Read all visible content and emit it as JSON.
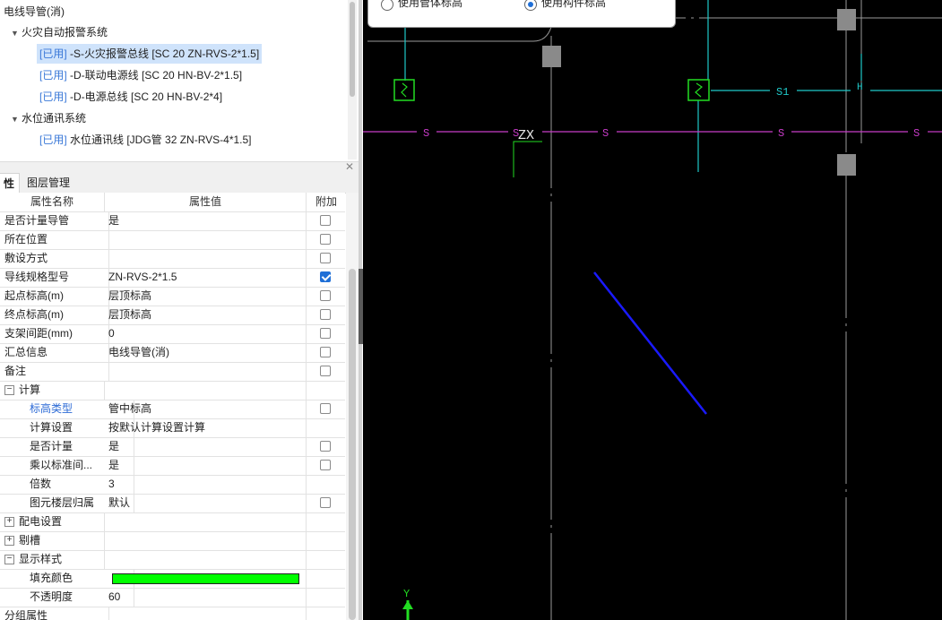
{
  "tree": {
    "root_label": "电线导管(消)",
    "groups": [
      {
        "label": "火灾自动报警系统",
        "items": [
          {
            "tag": "[已用]",
            "text": "-S-火灾报警总线 [SC 20 ZN-RVS-2*1.5]",
            "selected": true
          },
          {
            "tag": "[已用]",
            "text": "-D-联动电源线 [SC 20 HN-BV-2*1.5]"
          },
          {
            "tag": "[已用]",
            "text": "-D-电源总线 [SC 20 HN-BV-2*4]"
          }
        ]
      },
      {
        "label": "水位通讯系统",
        "items": [
          {
            "tag": "[已用]",
            "text": "水位通讯线 [JDG管 32 ZN-RVS-4*1.5]"
          }
        ]
      }
    ]
  },
  "tabs": {
    "properties": "性",
    "layers": "图层管理"
  },
  "grid": {
    "headers": {
      "name": "属性名称",
      "value": "属性值",
      "extra": "附加"
    },
    "rows": [
      {
        "name": "是否计量导管",
        "value": "是",
        "check": "off"
      },
      {
        "name": "所在位置",
        "value": "",
        "check": "off"
      },
      {
        "name": "敷设方式",
        "value": "",
        "check": "off"
      },
      {
        "name": "导线规格型号",
        "value": "ZN-RVS-2*1.5",
        "check": "on"
      },
      {
        "name": "起点标高(m)",
        "value": "层顶标高",
        "check": "off"
      },
      {
        "name": "终点标高(m)",
        "value": "层顶标高",
        "check": "off"
      },
      {
        "name": "支架间距(mm)",
        "value": "0",
        "check": "off"
      },
      {
        "name": "汇总信息",
        "value": "电线导管(消)",
        "check": "off"
      },
      {
        "name": "备注",
        "value": "",
        "check": "off"
      }
    ],
    "calc": {
      "label": "计算",
      "rows": [
        {
          "name": "标高类型",
          "value": "管中标高",
          "check": "off",
          "blue": true
        },
        {
          "name": "计算设置",
          "value": "按默认计算设置计算",
          "check": "none"
        },
        {
          "name": "是否计量",
          "value": "是",
          "check": "off"
        },
        {
          "name": "乘以标准间...",
          "value": "是",
          "check": "off"
        },
        {
          "name": "倍数",
          "value": "3",
          "check": "none"
        },
        {
          "name": "图元楼层归属",
          "value": "默认",
          "check": "off"
        }
      ]
    },
    "power_label": "配电设置",
    "groove_label": "剔槽",
    "display": {
      "label": "显示样式",
      "fill_label": "填充颜色",
      "fill_color": "#00ff00",
      "opacity_label": "不透明度",
      "opacity_value": "60"
    },
    "group_attr_label": "分组属性"
  },
  "popup": {
    "option_a": "使用管体标高",
    "option_b": "使用构件标高",
    "selected": "option_b"
  },
  "cad": {
    "labels": {
      "s": "S",
      "s1": "S1",
      "zx": "ZX",
      "y_axis": "Y"
    },
    "colors": {
      "grid": "#a0a0a0",
      "magenta": "#c83cc8",
      "cyan": "#1fc9c9",
      "green": "#22dd22",
      "blue": "#1a1aff",
      "gray_block": "#8a8a8a"
    }
  }
}
